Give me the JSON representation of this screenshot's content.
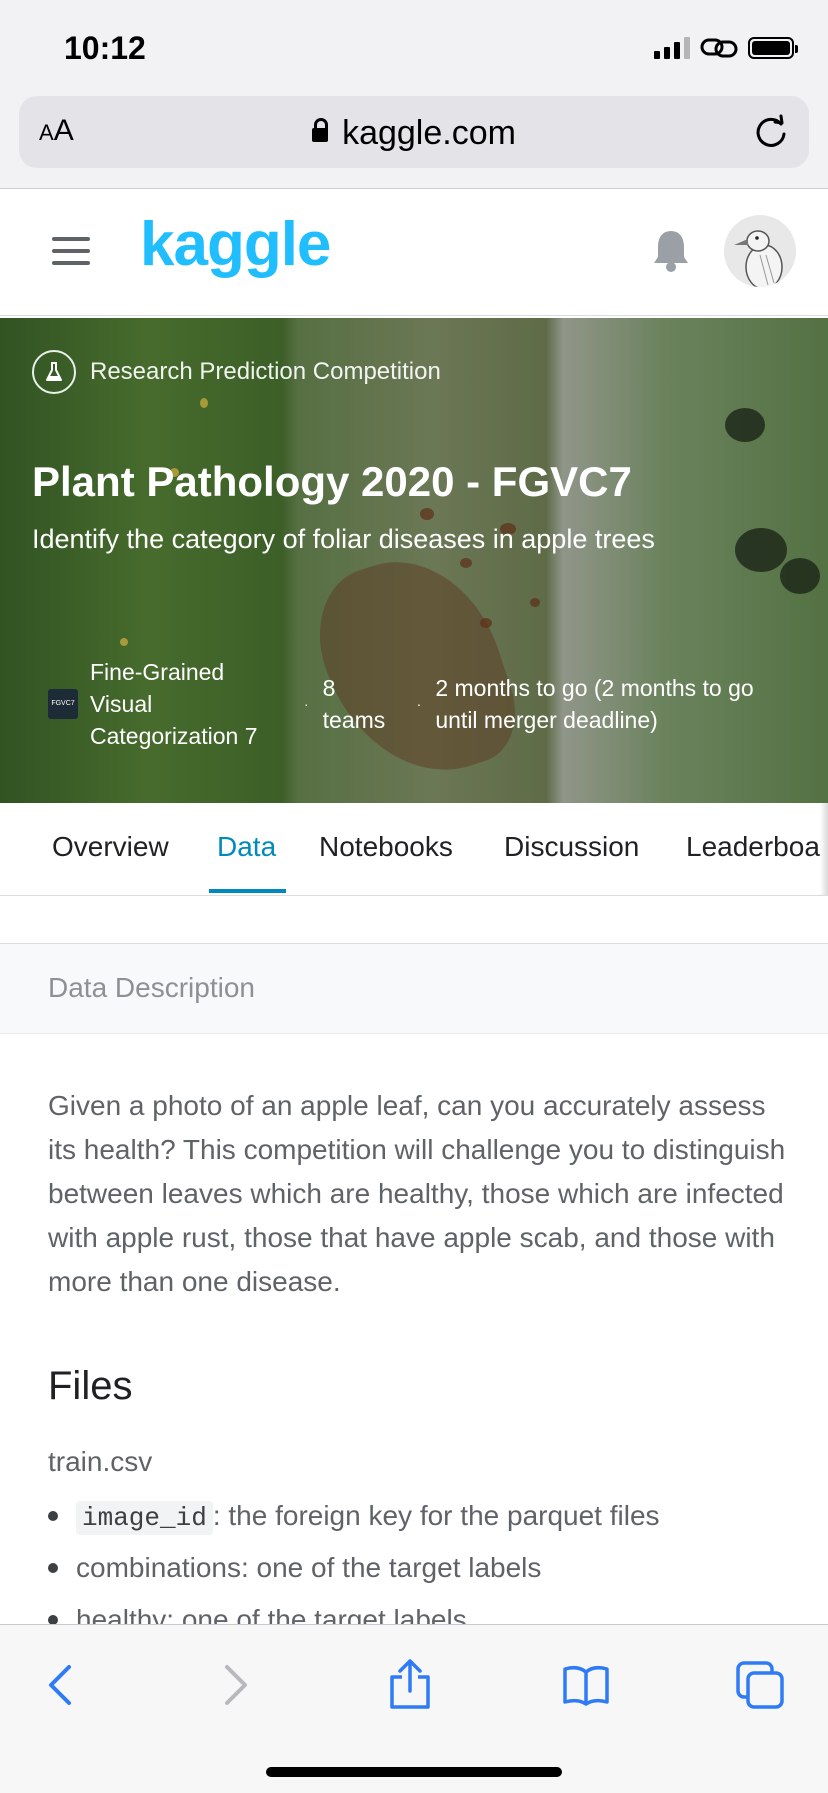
{
  "status_bar": {
    "time": "10:12"
  },
  "browser": {
    "text_size_label": "AA",
    "url": "kaggle.com"
  },
  "kaggle_header": {
    "logo": "kaggle"
  },
  "hero": {
    "competition_type": "Research Prediction Competition",
    "title": "Plant Pathology 2020 - FGVC7",
    "subtitle": "Identify the category of foliar diseases in apple trees",
    "org_logo_text": "FGVC7",
    "organization": "Fine-Grained Visual Categorization 7",
    "teams": "8 teams",
    "time_remaining": "2 months to go (2 months to go until merger deadline)"
  },
  "tabs": [
    {
      "label": "Overview"
    },
    {
      "label": "Data"
    },
    {
      "label": "Notebooks"
    },
    {
      "label": "Discussion"
    },
    {
      "label": "Leaderboa"
    }
  ],
  "data_description": {
    "header": "Data Description",
    "text": "Given a photo of an apple leaf, can you accurately assess its health? This competition will challenge you to distinguish between leaves which are healthy, those which are infected with apple rust, those that have apple scab, and those with more than one disease."
  },
  "files": {
    "heading": "Files",
    "file_name": "train.csv",
    "bullets": [
      {
        "code": "image_id",
        "text": ": the foreign key for the parquet files"
      },
      {
        "text": "combinations: one of the target labels"
      },
      {
        "text": "healthy: one of the target labels"
      }
    ]
  },
  "colors": {
    "kaggle_blue": "#20beff",
    "tab_active": "#008abc",
    "ios_blue": "#2f7bf5"
  }
}
